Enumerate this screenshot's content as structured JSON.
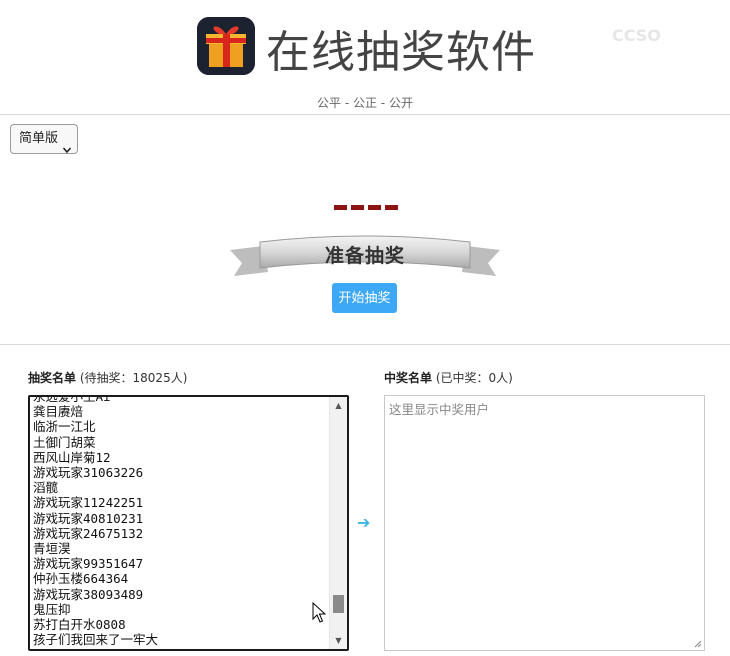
{
  "header": {
    "title": "在线抽奖软件",
    "subtitle": "公平 - 公正 - 公开",
    "logo_icon": "gift-box-icon",
    "watermark": "CCSO"
  },
  "controls": {
    "version_select": "简单版",
    "start_button": "开始抽奖"
  },
  "stage": {
    "dashes": "----",
    "banner_text": "准备抽奖"
  },
  "pool": {
    "title": "抽奖名单",
    "count_text": "(待抽奖：18025人)",
    "names": [
      "永远爱小王Ai",
      "龚目赓焙",
      "临浙一江北",
      "土御门胡菜",
      "西风山岸菊12",
      "游戏玩家31063226",
      "滔髋",
      "游戏玩家11242251",
      "游戏玩家40810231",
      "游戏玩家24675132",
      "青垣淏",
      "游戏玩家99351647",
      "仲孙玉楼664364",
      "游戏玩家38093489",
      "鬼压抑",
      "苏打白开水0808",
      "孩子们我回来了一牢大"
    ]
  },
  "winners": {
    "title": "中奖名单",
    "count_text": "(已中奖：0人)",
    "placeholder": "这里显示中奖用户"
  },
  "colors": {
    "button": "#3da8f5",
    "dash": "#8c1414",
    "arrow": "#3cb6e0"
  }
}
